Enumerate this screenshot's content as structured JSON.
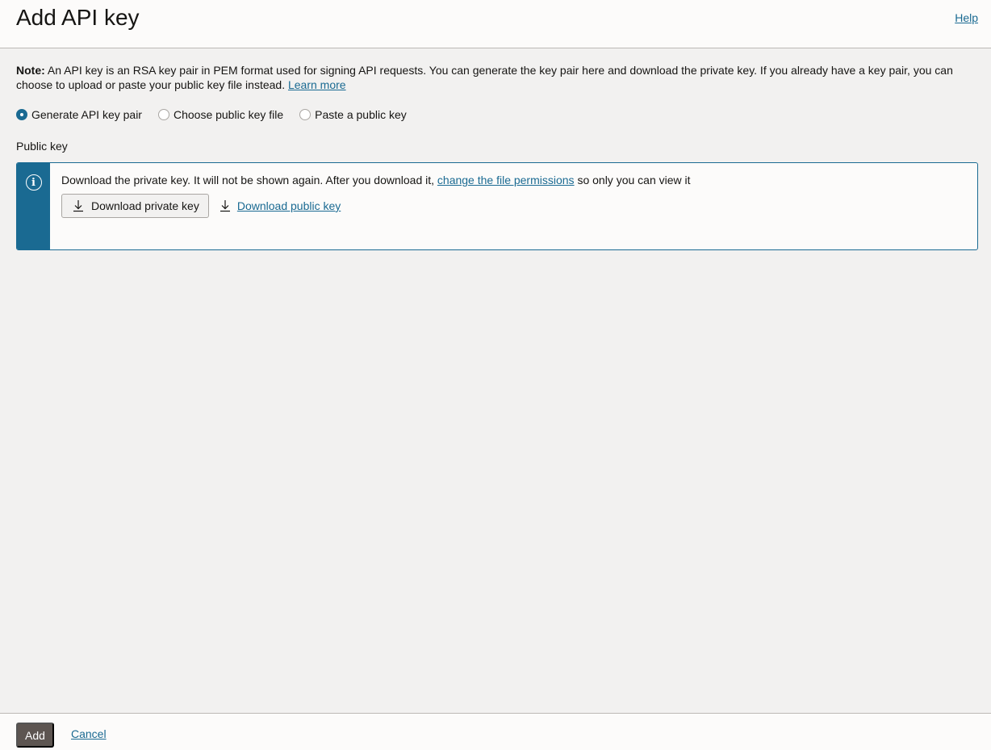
{
  "header": {
    "title": "Add API key",
    "help_label": "Help"
  },
  "note": {
    "prefix": "Note:",
    "text": " An API key is an RSA key pair in PEM format used for signing API requests. You can generate the key pair here and download the private key. If you already have a key pair, you can choose to upload or paste your public key file instead. ",
    "learn_more_label": "Learn more"
  },
  "key_source": {
    "options": [
      {
        "label": "Generate API key pair",
        "checked": true
      },
      {
        "label": "Choose public key file",
        "checked": false
      },
      {
        "label": "Paste a public key",
        "checked": false
      }
    ]
  },
  "public_key": {
    "label": "Public key",
    "info": {
      "icon": "info-icon",
      "text_before": "Download the private key. It will not be shown again. After you download it, ",
      "link_label": "change the file permissions",
      "text_after": " so only you can view it"
    },
    "download_private_label": "Download private key",
    "download_public_label": "Download public key"
  },
  "footer": {
    "add_label": "Add",
    "cancel_label": "Cancel"
  },
  "colors": {
    "accent": "#1a6a92",
    "primary_button": "#5d5551",
    "background": "#f2f1f0"
  }
}
